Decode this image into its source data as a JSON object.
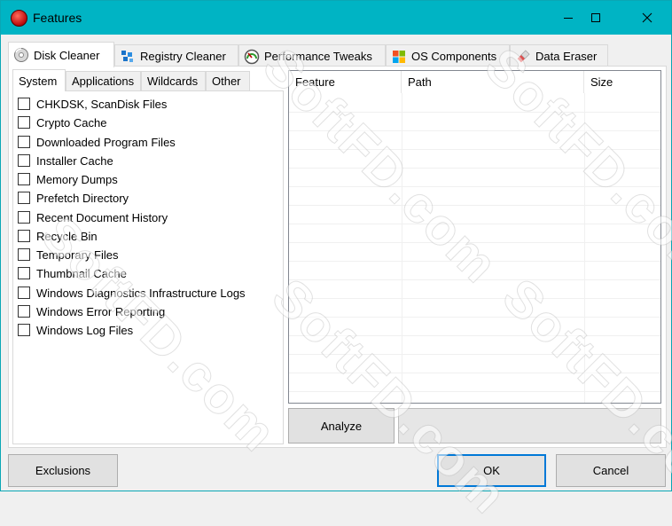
{
  "window": {
    "title": "Features"
  },
  "main_tabs": [
    {
      "label": "Disk Cleaner",
      "icon": "disk-icon"
    },
    {
      "label": "Registry Cleaner",
      "icon": "registry-icon"
    },
    {
      "label": "Performance Tweaks",
      "icon": "gauge-icon"
    },
    {
      "label": "OS Components",
      "icon": "windows-logo-icon"
    },
    {
      "label": "Data Eraser",
      "icon": "eraser-icon"
    }
  ],
  "sub_tabs": [
    "System",
    "Applications",
    "Wildcards",
    "Other"
  ],
  "items": [
    "CHKDSK, ScanDisk Files",
    "Crypto Cache",
    "Downloaded Program Files",
    "Installer Cache",
    "Memory Dumps",
    "Prefetch Directory",
    "Recent Document History",
    "Recycle Bin",
    "Temporary Files",
    "Thumbnail Cache",
    "Windows Diagnostics Infrastructure Logs",
    "Windows Error Reporting",
    "Windows Log Files"
  ],
  "columns": [
    "Feature",
    "Path",
    "Size"
  ],
  "buttons": {
    "analyze": "Analyze",
    "exclusions": "Exclusions",
    "ok": "OK",
    "cancel": "Cancel"
  },
  "watermark": "SoftFD.com",
  "colors": {
    "titlebar": "#00b4c4",
    "accent": "#0078d7"
  }
}
